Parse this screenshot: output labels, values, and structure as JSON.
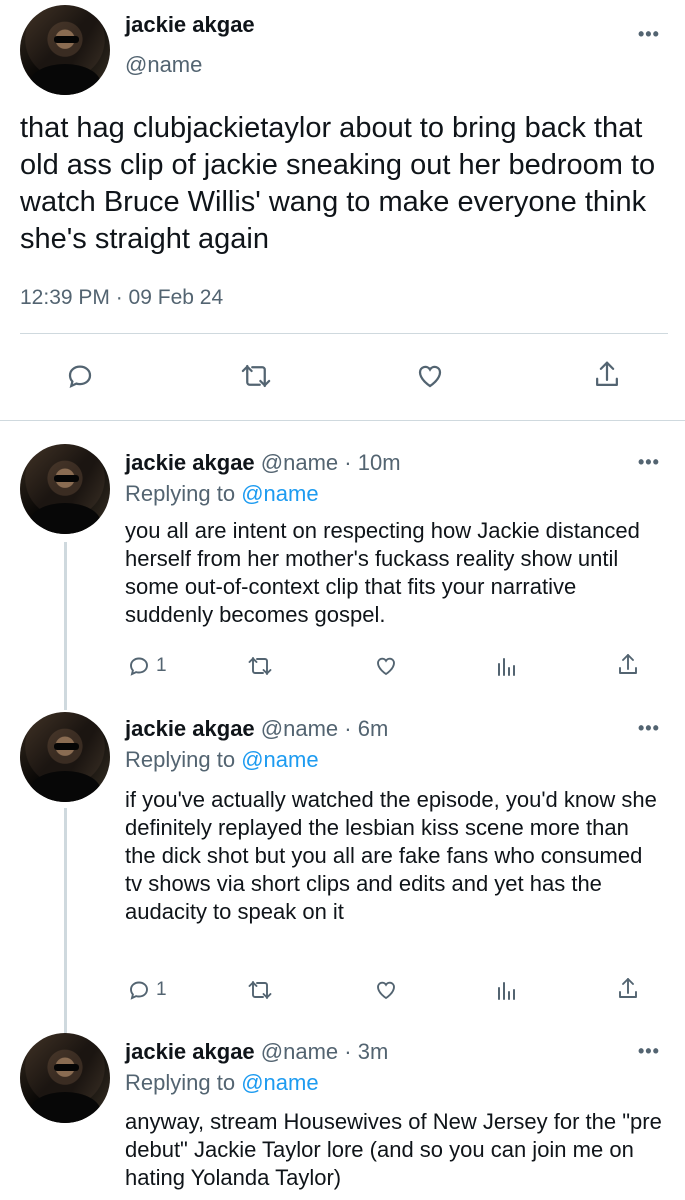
{
  "main_tweet": {
    "author_name": "jackie akgae",
    "author_handle": "@name",
    "text": "that hag clubjackietaylor about to bring back that old ass clip of jackie sneaking out her bedroom to watch Bruce Willis' wang to make everyone think she's straight again",
    "timestamp": "12:39 PM · 09 Feb 24",
    "more_icon": "more-horizontal-icon",
    "actions": [
      "reply-icon",
      "retweet-icon",
      "like-icon",
      "share-icon"
    ]
  },
  "replies": [
    {
      "author_name": "jackie akgae",
      "author_handle": "@name",
      "separator": "·",
      "time": "10m",
      "replying_prefix": "Replying to",
      "replying_to": "@name",
      "text": "you all are intent on respecting how Jackie distanced herself from her mother's fuckass reality show until some out-of-context clip that fits your narrative suddenly becomes gospel.",
      "reply_count": "1"
    },
    {
      "author_name": "jackie akgae",
      "author_handle": "@name",
      "separator": "·",
      "time": "6m",
      "replying_prefix": "Replying to",
      "replying_to": "@name",
      "text": "if you've actually watched the episode, you'd know she definitely replayed the lesbian kiss scene more than the dick shot but you all are fake fans who consumed tv shows via short clips and edits and yet has the audacity to speak on it",
      "reply_count": "1"
    },
    {
      "author_name": "jackie akgae",
      "author_handle": "@name",
      "separator": "·",
      "time": "3m",
      "replying_prefix": "Replying to",
      "replying_to": "@name",
      "text": "anyway, stream Housewives of New Jersey for the \"pre debut\" Jackie Taylor lore (and so you can join me on hating Yolanda Taylor)"
    }
  ],
  "more_label": "•••",
  "colors": {
    "text": "#0f1419",
    "secondary": "#536471",
    "link": "#1d9bf0",
    "divider": "#cfd9de"
  }
}
